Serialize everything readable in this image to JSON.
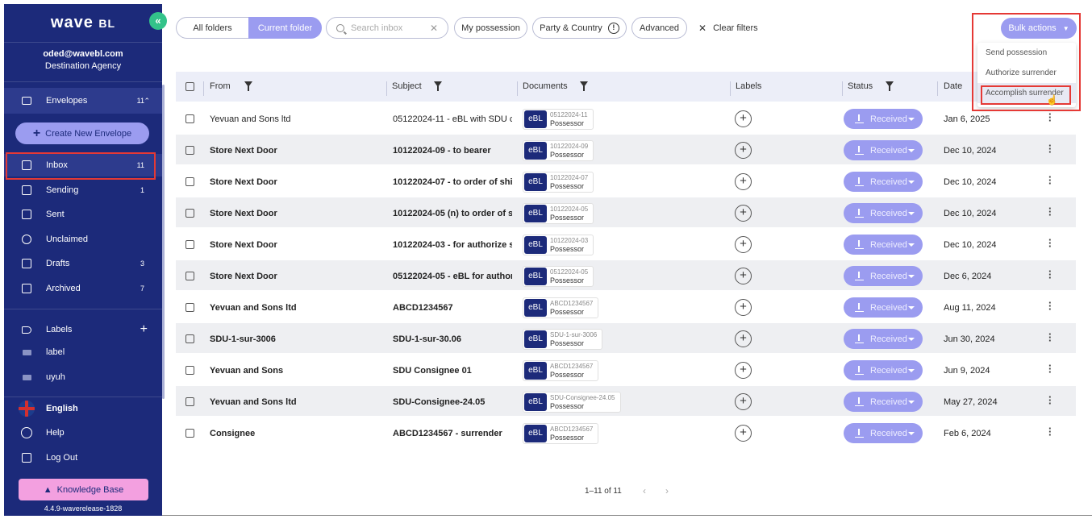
{
  "sidebar": {
    "logo": "wave",
    "logo_suffix": "BL",
    "collapse_glyph": "«",
    "user_email": "oded@wavebl.com",
    "user_org": "Destination Agency",
    "envelopes": {
      "label": "Envelopes",
      "count": "11",
      "chevron": "⌃"
    },
    "new_envelope": "Create New Envelope",
    "nav": [
      {
        "label": "Inbox",
        "count": "11"
      },
      {
        "label": "Sending",
        "count": "1"
      },
      {
        "label": "Sent",
        "count": ""
      },
      {
        "label": "Unclaimed",
        "count": ""
      },
      {
        "label": "Drafts",
        "count": "3"
      },
      {
        "label": "Archived",
        "count": "7"
      }
    ],
    "labels_header": "Labels",
    "labels": [
      "label",
      "uyuh"
    ],
    "language": "English",
    "help": "Help",
    "logout": "Log Out",
    "knowledge_base": "Knowledge Base",
    "version": "4.4.9-waverelease-1828"
  },
  "toolbar": {
    "all_folders": "All folders",
    "current_folder": "Current folder",
    "search_placeholder": "Search inbox",
    "my_possession": "My possession",
    "party_country": "Party & Country",
    "advanced": "Advanced",
    "clear_filters": "Clear filters",
    "bulk_actions": "Bulk actions"
  },
  "bulk_menu": [
    "Send possession",
    "Authorize surrender",
    "Accomplish surrender"
  ],
  "table": {
    "columns": [
      "From",
      "Subject",
      "Documents",
      "Labels",
      "Status",
      "Date"
    ],
    "rows": [
      {
        "from": "Yevuan and Sons ltd",
        "subject": "05122024-11 - eBL with SDU c...",
        "doc_num": "05122024-11",
        "doc_role": "Possessor",
        "status": "Received",
        "date": "Jan 6, 2025",
        "bold": false
      },
      {
        "from": "Store Next Door",
        "subject": "10122024-09 - to bearer",
        "doc_num": "10122024-09",
        "doc_role": "Possessor",
        "status": "Received",
        "date": "Dec 10, 2024",
        "bold": true
      },
      {
        "from": "Store Next Door",
        "subject": "10122024-07 - to order of shi...",
        "doc_num": "10122024-07",
        "doc_role": "Possessor",
        "status": "Received",
        "date": "Dec 10, 2024",
        "bold": true
      },
      {
        "from": "Store Next Door",
        "subject": "10122024-05 (n) to order of s...",
        "doc_num": "10122024-05",
        "doc_role": "Possessor",
        "status": "Received",
        "date": "Dec 10, 2024",
        "bold": true
      },
      {
        "from": "Store Next Door",
        "subject": "10122024-03 - for authorize s...",
        "doc_num": "10122024-03",
        "doc_role": "Possessor",
        "status": "Received",
        "date": "Dec 10, 2024",
        "bold": true
      },
      {
        "from": "Store Next Door",
        "subject": "05122024-05 - eBL for author...",
        "doc_num": "05122024-05",
        "doc_role": "Possessor",
        "status": "Received",
        "date": "Dec 6, 2024",
        "bold": true
      },
      {
        "from": "Yevuan and Sons ltd",
        "subject": "ABCD1234567",
        "doc_num": "ABCD1234567",
        "doc_role": "Possessor",
        "status": "Received",
        "date": "Aug 11, 2024",
        "bold": true
      },
      {
        "from": "SDU-1-sur-3006",
        "subject": "SDU-1-sur-30.06",
        "doc_num": "SDU-1-sur-3006",
        "doc_role": "Possessor",
        "status": "Received",
        "date": "Jun 30, 2024",
        "bold": true
      },
      {
        "from": "Yevuan and Sons",
        "subject": "SDU Consignee 01",
        "doc_num": "ABCD1234567",
        "doc_role": "Possessor",
        "status": "Received",
        "date": "Jun 9, 2024",
        "bold": true
      },
      {
        "from": "Yevuan and Sons ltd",
        "subject": "SDU-Consignee-24.05",
        "doc_num": "SDU-Consignee-24.05",
        "doc_role": "Possessor",
        "status": "Received",
        "date": "May 27, 2024",
        "bold": true
      },
      {
        "from": "Consignee",
        "subject": "ABCD1234567 - surrender",
        "doc_num": "ABCD1234567",
        "doc_role": "Possessor",
        "status": "Received",
        "date": "Feb 6, 2024",
        "bold": true
      }
    ],
    "doc_badge": "eBL"
  },
  "pagination": {
    "range": "1–11 of 11",
    "prev": "‹",
    "next": "›"
  },
  "colors": {
    "sidebar": "#1c2a7a",
    "accent": "#9b9cf0",
    "green": "#33c38a",
    "kb": "#f3a0e0",
    "highlight": "#e53935"
  }
}
